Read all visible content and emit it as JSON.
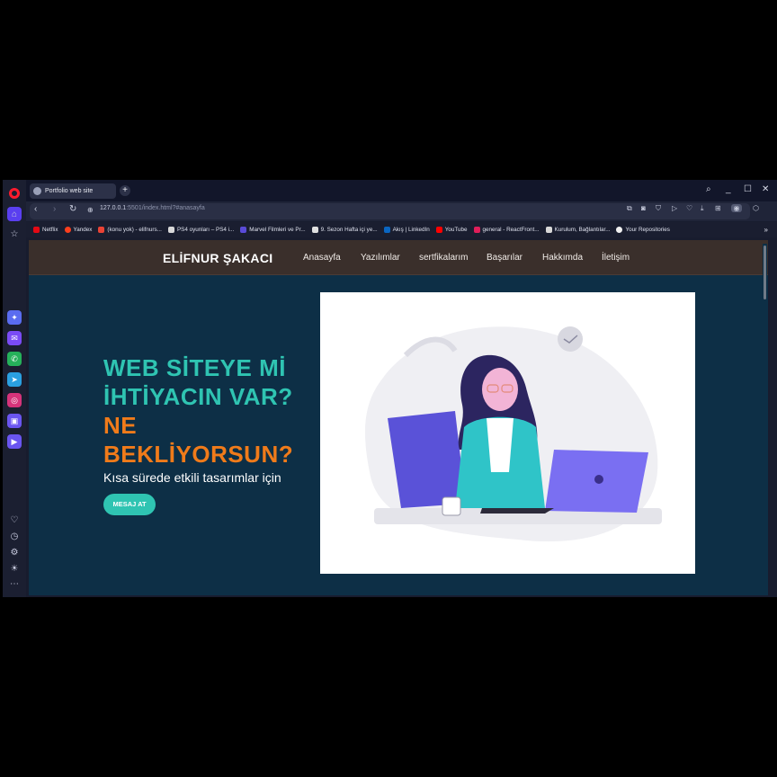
{
  "browser": {
    "tab_title": "Portfolio web site",
    "url_host": "127.0.0.1",
    "url_rest": ":5501/index.html?#anasayfa"
  },
  "bookmarks": [
    {
      "label": "Netflix",
      "color": "#e50914"
    },
    {
      "label": "Yandex",
      "color": "#fc3f1d"
    },
    {
      "label": "(konu yok) - elifnurs...",
      "color": "#ea4335"
    },
    {
      "label": "PS4 oyunları – PS4 i...",
      "color": "#d8d8d8"
    },
    {
      "label": "Marvel Filmleri ve Pr...",
      "color": "#5a4bd8"
    },
    {
      "label": "9. Sezon Hafta içi ye...",
      "color": "#e0e0e0"
    },
    {
      "label": "Akış | LinkedIn",
      "color": "#0a66c2"
    },
    {
      "label": "YouTube",
      "color": "#ff0000"
    },
    {
      "label": "general - ReactFront...",
      "color": "#e01e5a"
    },
    {
      "label": "Kurulum, Bağlantılar...",
      "color": "#d8d8d8"
    },
    {
      "label": "Your Repositories",
      "color": "#f0f0f0"
    }
  ],
  "site": {
    "brand": "ELİFNUR ŞAKACI",
    "nav": [
      "Anasayfa",
      "Yazılımlar",
      "sertfikalarım",
      "Başarılar",
      "Hakkımda",
      "İletişim"
    ],
    "hero": {
      "line1": "WEB SİTEYE Mİ",
      "line2": "İHTİYACIN VAR?",
      "line3": "NE",
      "line4": "BEKLİYORSUN?",
      "subtitle": "Kısa sürede etkili tasarımlar için",
      "cta": "MESAJ AT"
    },
    "colors": {
      "accent": "#2fc4b2",
      "orange": "#f07b1a",
      "background": "#0d2f46",
      "navbar": "#3a2f2b"
    }
  }
}
